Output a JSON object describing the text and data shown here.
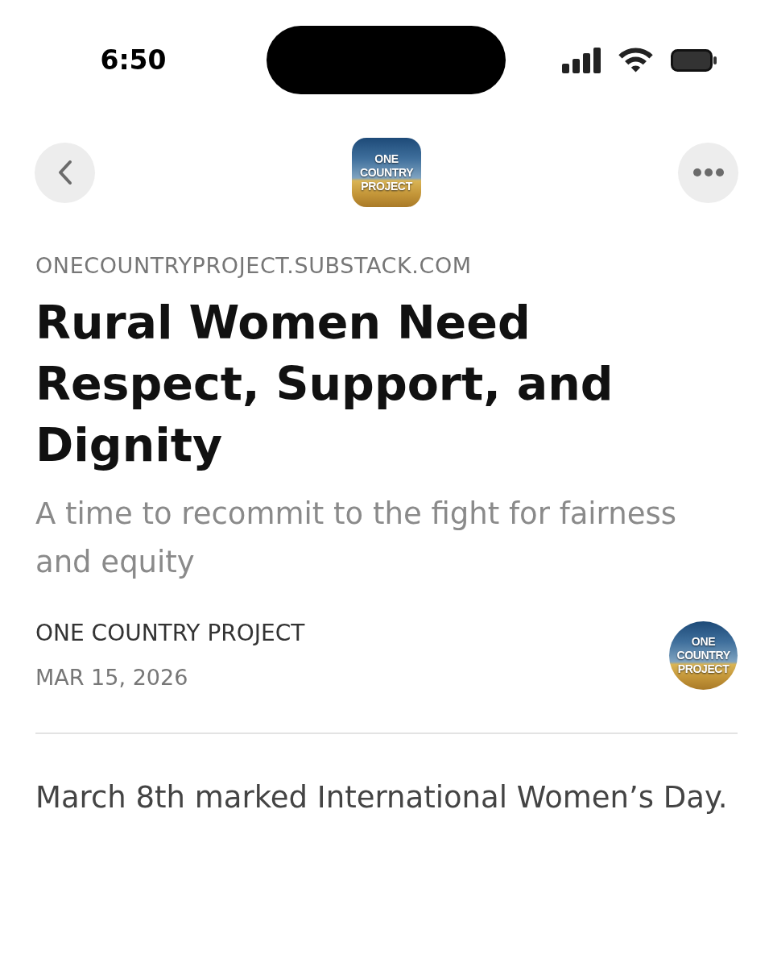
{
  "status_bar": {
    "time": "6:50"
  },
  "nav": {
    "logo_text": "ONE COUNTRY PROJECT"
  },
  "post": {
    "domain": "ONECOUNTRYPROJECT.SUBSTACK.COM",
    "title": "Rural Women Need Respect, Support, and Dignity",
    "subtitle": "A time to recommit to the fight for fairness and equity",
    "byline": {
      "author": "ONE COUNTRY PROJECT",
      "date": "MAR 15, 2026",
      "avatar_text": "ONE COUNTRY PROJECT"
    }
  },
  "body": [
    "March 8th marked International Women’s Day."
  ]
}
